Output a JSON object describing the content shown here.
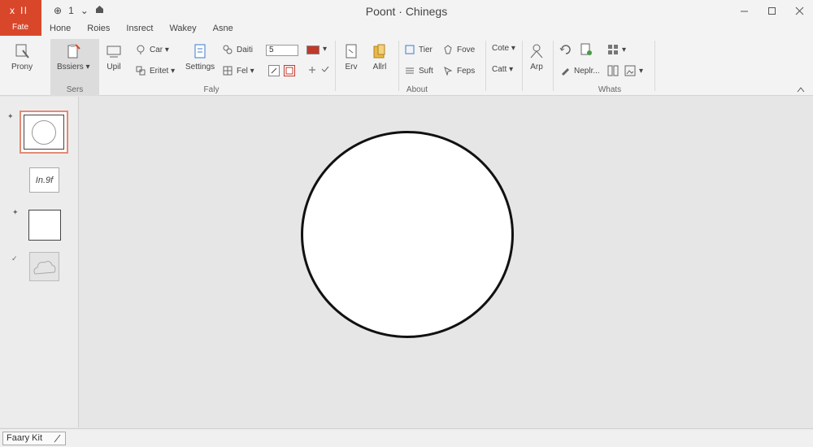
{
  "app": {
    "badge_glyph": "x ll",
    "file_tab": "Fate",
    "qat": [
      "⊕",
      "1",
      "⌄"
    ],
    "doc_title": "Poont · Chinegs"
  },
  "tabs": [
    "Hone",
    "Roies",
    "Insrect",
    "Wakey",
    "Asne"
  ],
  "ribbon": {
    "buttons": {
      "prony": "Prony",
      "bssiers": "Bssiers ▾",
      "upil": "Upil",
      "settings": "Settings",
      "erv": "Erv",
      "allrl": "Allrl",
      "arp": "Arp"
    },
    "small": {
      "car": "Car ▾",
      "eritet": "Eritet ▾",
      "daiti": "Daiti",
      "fel": "Fel ▾",
      "size_value": "5",
      "tier": "Tier",
      "fove": "Fove",
      "suft": "Suft",
      "feps": "Feps",
      "cote": "Cote ▾",
      "catt": "Catt ▾",
      "neplr": "Neplr...",
      "ellipsis": "▾"
    },
    "groups": {
      "sers": "Sers",
      "faly": "Faly",
      "about": "About",
      "whats": "Whats"
    }
  },
  "slides": {
    "thumb2_text": "In.9f"
  },
  "status": {
    "label": "Faary Kit"
  },
  "colors": {
    "accent": "#d9472b",
    "font_color_swatch": "#c0392b"
  },
  "icons": [
    "paint-brush-icon",
    "paste-icon",
    "lock-icon",
    "document-icon",
    "folder-icon",
    "person-icon",
    "undo-icon"
  ]
}
